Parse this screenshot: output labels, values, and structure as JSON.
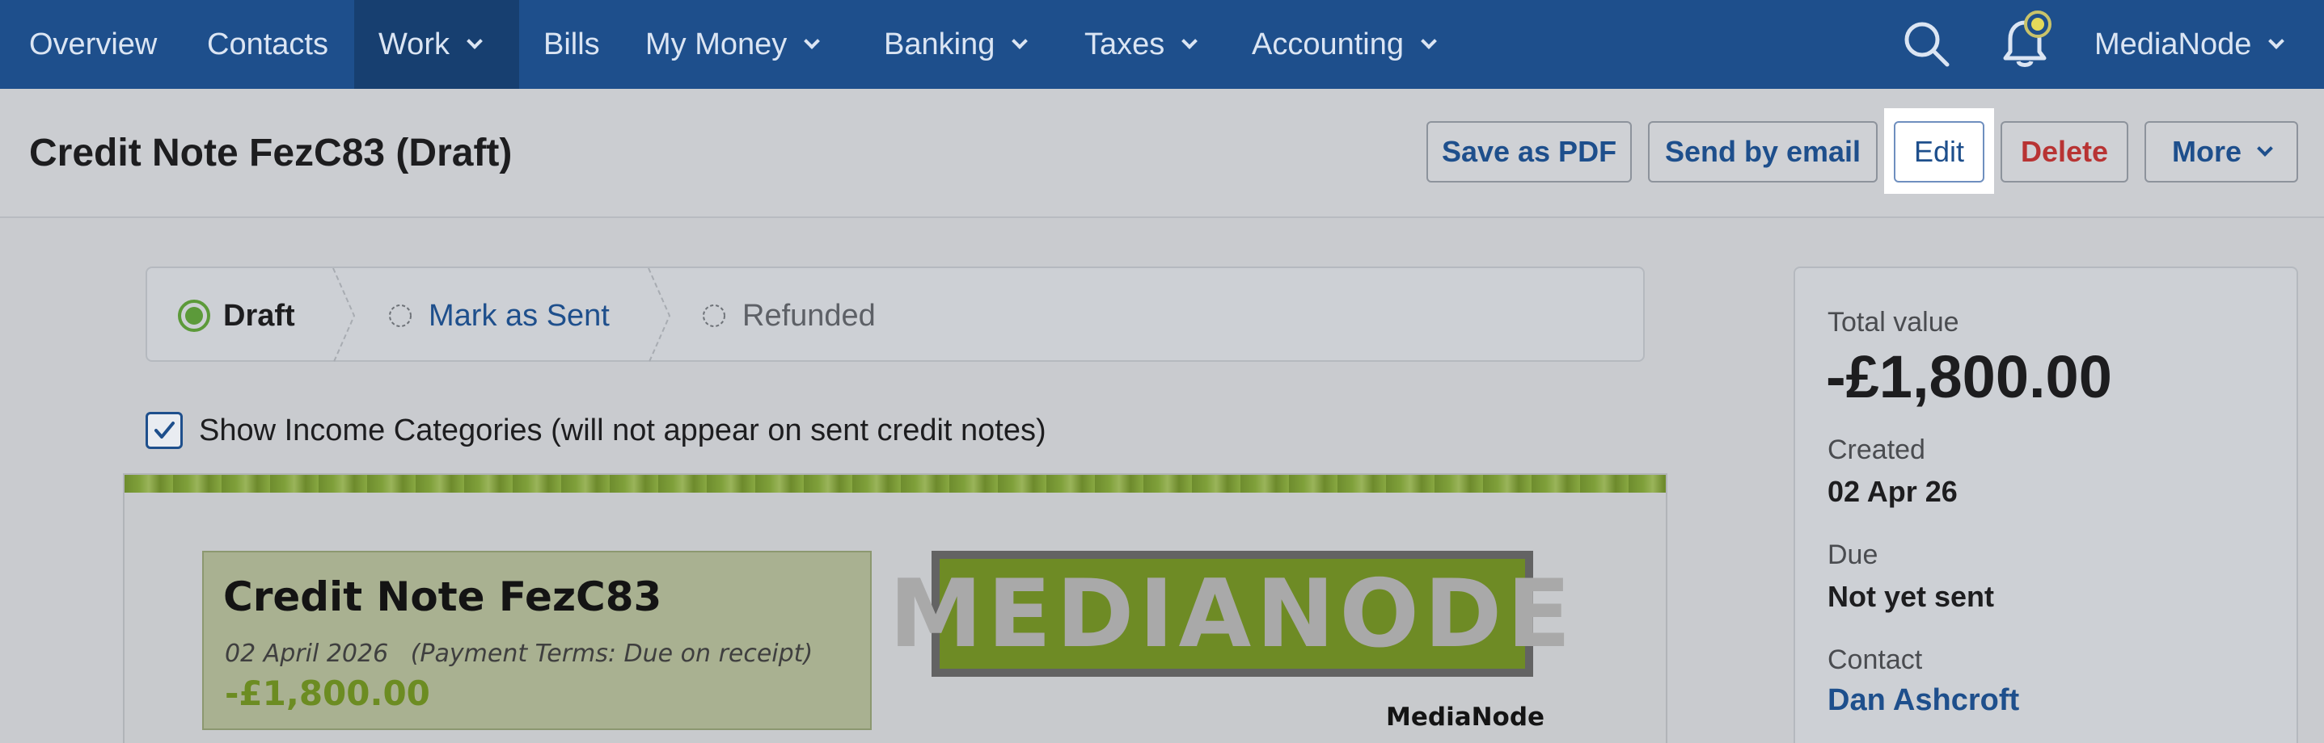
{
  "nav": {
    "items": [
      {
        "label": "Overview"
      },
      {
        "label": "Contacts"
      },
      {
        "label": "Work"
      },
      {
        "label": "Bills"
      },
      {
        "label": "My Money"
      },
      {
        "label": "Banking"
      },
      {
        "label": "Taxes"
      },
      {
        "label": "Accounting"
      }
    ],
    "account_label": "MediaNode",
    "active_item": "Work",
    "bg_color": "#1e4f8c"
  },
  "header": {
    "title": "Credit Note FezC83 (Draft)",
    "buttons": {
      "save_pdf": "Save as PDF",
      "send_email": "Send by email",
      "edit": "Edit",
      "delete": "Delete",
      "more": "More"
    }
  },
  "steps": {
    "draft": "Draft",
    "mark_sent": "Mark as Sent",
    "refunded": "Refunded",
    "current": "Draft"
  },
  "show_income": {
    "label": "Show Income Categories (will not appear on sent credit notes)",
    "checked": true
  },
  "document": {
    "title": "Credit Note FezC83",
    "date": "02 April 2026",
    "terms": "(Payment Terms: Due on receipt)",
    "amount": "-£1,800.00",
    "logo_text": "MEDIANODE",
    "company_name": "MediaNode",
    "accent_color": "#6c8c22"
  },
  "summary": {
    "total_label": "Total value",
    "total_value": "-£1,800.00",
    "created_label": "Created",
    "created_value": "02 Apr 26",
    "due_label": "Due",
    "due_value": "Not yet sent",
    "contact_label": "Contact",
    "contact_value": "Dan Ashcroft"
  }
}
